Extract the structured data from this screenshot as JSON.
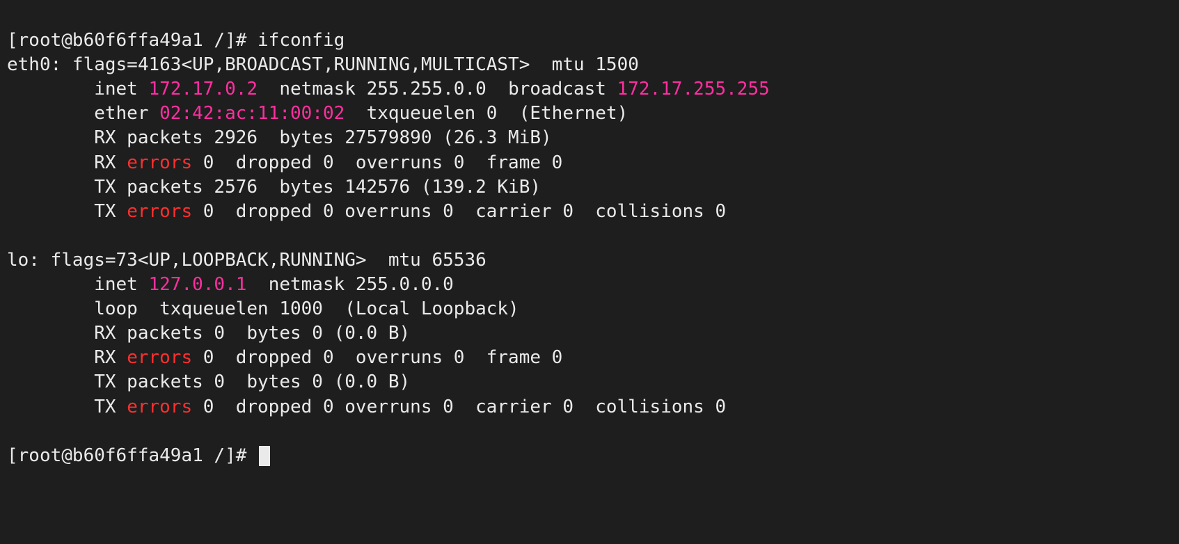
{
  "colors": {
    "background": "#1e1e1e",
    "foreground": "#eaeaea",
    "magenta": "#ff2fa0",
    "red": "#ff2f2f"
  },
  "prompt": "[root@b60f6ffa49a1 /]# ",
  "command": "ifconfig",
  "interfaces": [
    {
      "name": "eth0",
      "flags_line": "eth0: flags=4163<UP,BROADCAST,RUNNING,MULTICAST>  mtu 1500",
      "inet_prefix": "        inet ",
      "inet_addr": "172.17.0.2",
      "inet_rest": "  netmask 255.255.0.0  broadcast ",
      "broadcast": "172.17.255.255",
      "ether_prefix": "        ether ",
      "ether_addr": "02:42:ac:11:00:02",
      "ether_rest": "  txqueuelen 0  (Ethernet)",
      "rx_packets": "        RX packets 2926  bytes 27579890 (26.3 MiB)",
      "rx_err_prefix": "        RX ",
      "rx_err_word": "errors",
      "rx_err_rest": " 0  dropped 0  overruns 0  frame 0",
      "tx_packets": "        TX packets 2576  bytes 142576 (139.2 KiB)",
      "tx_err_prefix": "        TX ",
      "tx_err_word": "errors",
      "tx_err_rest": " 0  dropped 0 overruns 0  carrier 0  collisions 0"
    },
    {
      "name": "lo",
      "flags_line": "lo: flags=73<UP,LOOPBACK,RUNNING>  mtu 65536",
      "inet_prefix": "        inet ",
      "inet_addr": "127.0.0.1",
      "inet_rest": "  netmask 255.0.0.0",
      "broadcast": "",
      "ether_prefix": "        loop  txqueuelen 1000  (Local Loopback)",
      "ether_addr": "",
      "ether_rest": "",
      "rx_packets": "        RX packets 0  bytes 0 (0.0 B)",
      "rx_err_prefix": "        RX ",
      "rx_err_word": "errors",
      "rx_err_rest": " 0  dropped 0  overruns 0  frame 0",
      "tx_packets": "        TX packets 0  bytes 0 (0.0 B)",
      "tx_err_prefix": "        TX ",
      "tx_err_word": "errors",
      "tx_err_rest": " 0  dropped 0 overruns 0  carrier 0  collisions 0"
    }
  ],
  "blank": ""
}
